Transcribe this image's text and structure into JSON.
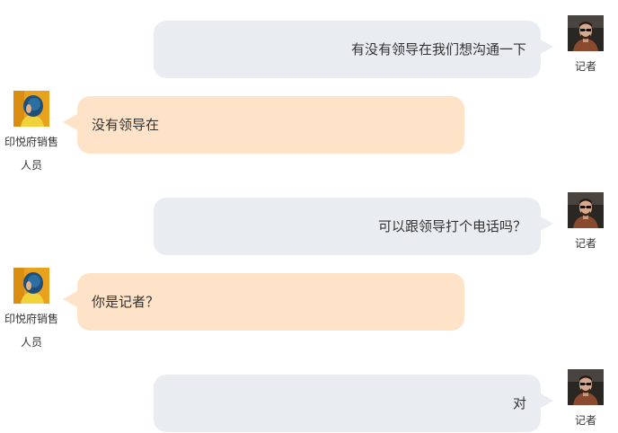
{
  "participants": {
    "reporter": {
      "name": "记者",
      "avatar_icon": "man-portrait-avatar"
    },
    "sales": {
      "name": "印悦府销售人员",
      "avatar_icon": "blue-hair-woman-avatar"
    }
  },
  "colors": {
    "reporter_bubble": "#e9edf2",
    "sales_bubble": "#fee3c8",
    "text": "#333333"
  },
  "messages": [
    {
      "sender": "reporter",
      "text": "有没有领导在我们想沟通一下"
    },
    {
      "sender": "sales",
      "text": "没有领导在"
    },
    {
      "sender": "reporter",
      "text": "可以跟领导打个电话吗？"
    },
    {
      "sender": "sales",
      "text": "你是记者？"
    },
    {
      "sender": "reporter",
      "text": "对"
    }
  ]
}
